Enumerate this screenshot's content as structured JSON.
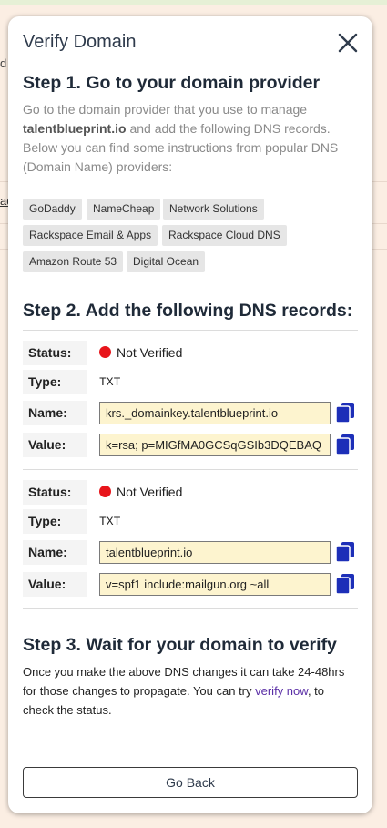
{
  "background": {
    "snippets": [
      "d",
      "ad"
    ]
  },
  "modal": {
    "title": "Verify Domain",
    "step1": {
      "heading": "Step 1. Go to your domain provider",
      "intro_before": "Go to the domain provider that you use to manage ",
      "domain": "talentblueprint.io",
      "intro_after": " and add the following DNS records. Below you can find some instructions from popular DNS (Domain Name) providers:",
      "providers": [
        "GoDaddy",
        "NameCheap",
        "Network Solutions",
        "Rackspace Email & Apps",
        "Rackspace Cloud DNS",
        "Amazon Route 53",
        "Digital Ocean"
      ]
    },
    "step2": {
      "heading": "Step 2. Add the following DNS records:",
      "labels": {
        "status": "Status:",
        "type": "Type:",
        "name": "Name:",
        "value": "Value:"
      },
      "records": [
        {
          "status": "Not Verified",
          "type": "TXT",
          "name": "krs._domainkey.talentblueprint.io",
          "value": "k=rsa; p=MIGfMA0GCSqGSIb3DQEBAQ"
        },
        {
          "status": "Not Verified",
          "type": "TXT",
          "name": "talentblueprint.io",
          "value": "v=spf1 include:mailgun.org ~all"
        }
      ],
      "status_color": "#e8151b"
    },
    "step3": {
      "heading": "Step 3. Wait for your domain to verify",
      "text_before": "Once you make the above DNS changes it can take 24-48hrs for those changes to propagate. You can try ",
      "link": "verify now",
      "text_after": ", to check the status."
    },
    "back_button": "Go Back"
  },
  "icons": {
    "close": "close-icon",
    "copy": "copy-icon"
  }
}
